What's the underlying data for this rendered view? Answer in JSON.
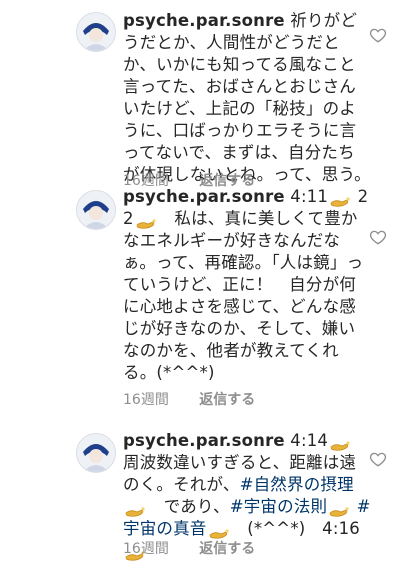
{
  "comments": [
    {
      "username": "psyche.par.sonre",
      "segments": [
        {
          "t": "text",
          "v": " 祈りがどうだとか、人間性がどうだとか、いかにも知ってる風なこと言ってた、おばさんとおじさんいたけど、上記の「秘技」のように、口ばっかりエラそうに言ってないで、まずは、自分たちが体現しないとね。って、思う。"
        }
      ],
      "time": "16週間",
      "reply": "返信する"
    },
    {
      "username": "psyche.par.sonre",
      "segments": [
        {
          "t": "text",
          "v": " 4:11"
        },
        {
          "t": "lamp"
        },
        {
          "t": "text",
          "v": " 22"
        },
        {
          "t": "lamp"
        },
        {
          "t": "text",
          "v": "　私は、真に美しくて豊かなエネルギーが好きなんだなぁ。って、再確認。「人は鏡」っていうけど、正に！　自分が何に心地よさを感じて、どんな感じが好きなのか、そして、嫌いなのかを、他者が教えてくれる。(*^^*)"
        }
      ],
      "time": "16週間",
      "reply": "返信する"
    },
    {
      "username": "psyche.par.sonre",
      "segments": [
        {
          "t": "text",
          "v": " 4:14"
        },
        {
          "t": "lamp"
        },
        {
          "t": "text",
          "v": "　周波数違いすぎると、距離は遠のく。それが、"
        },
        {
          "t": "tag",
          "v": "#自然界の摂理"
        },
        {
          "t": "lamp"
        },
        {
          "t": "text",
          "v": "　であり、"
        },
        {
          "t": "tag",
          "v": "#宇宙の法則"
        },
        {
          "t": "lamp"
        },
        {
          "t": "text",
          "v": " "
        },
        {
          "t": "tag",
          "v": "#宇宙の真音"
        },
        {
          "t": "lamp"
        },
        {
          "t": "text",
          "v": "　(*^^*)　4:16"
        },
        {
          "t": "lamp"
        }
      ],
      "time": "16週間",
      "reply": "返信する"
    }
  ],
  "icons": {
    "avatar": "profile-avatar",
    "like": "heart-outline-icon",
    "emoji": "oil-lamp-emoji"
  },
  "colors": {
    "text": "#262626",
    "muted": "#8e8e8e",
    "hashtag": "#003569",
    "lamp": "#e8b339"
  }
}
